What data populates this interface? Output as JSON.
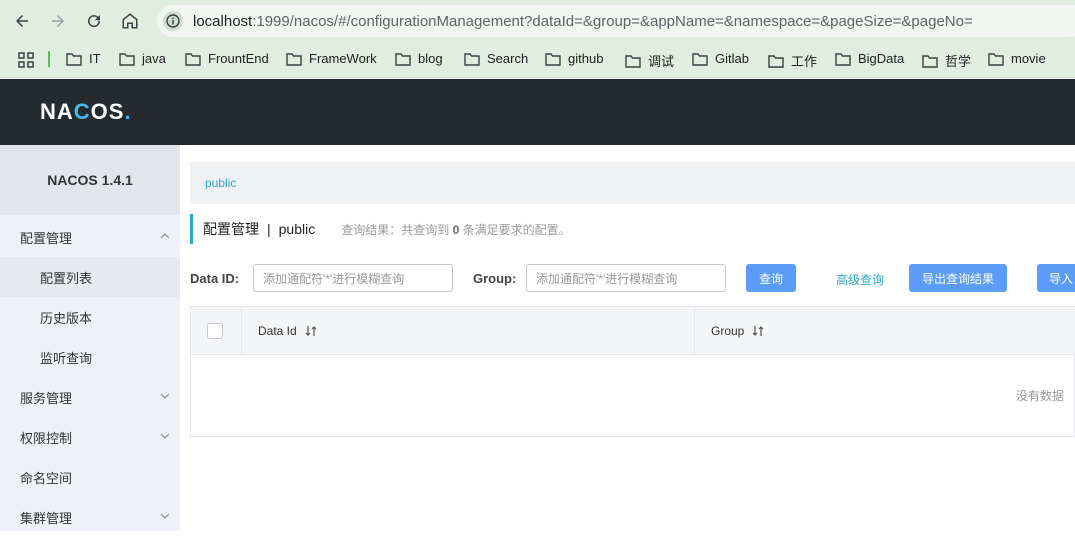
{
  "browser": {
    "url_host": "localhost",
    "url_rest": ":1999/nacos/#/configurationManagement?dataId=&group=&appName=&namespace=&pageSize=&pageNo=",
    "bookmarks": [
      "IT",
      "java",
      "FrountEnd",
      "FrameWork",
      "blog",
      "Search",
      "github",
      "调试",
      "Gitlab",
      "工作",
      "BigData",
      "哲学",
      "movie"
    ]
  },
  "app": {
    "logo": {
      "a": "NA",
      "b": "C",
      "c": "OS",
      "dot": "."
    },
    "version_title": "NACOS 1.4.1"
  },
  "sidebar": {
    "items": [
      {
        "label": "配置管理",
        "type": "group",
        "chevron": "up"
      },
      {
        "label": "配置列表",
        "type": "sub",
        "active": true
      },
      {
        "label": "历史版本",
        "type": "sub"
      },
      {
        "label": "监听查询",
        "type": "sub"
      },
      {
        "label": "服务管理",
        "type": "group",
        "chevron": "down"
      },
      {
        "label": "权限控制",
        "type": "group",
        "chevron": "down"
      },
      {
        "label": "命名空间",
        "type": "group"
      },
      {
        "label": "集群管理",
        "type": "group",
        "chevron": "down"
      }
    ]
  },
  "main": {
    "namespace_link": "public",
    "title": "配置管理",
    "title_sep": "|",
    "title_ns": "public",
    "result_prefix": "查询结果：共查询到",
    "result_count": "0",
    "result_suffix": "条满足要求的配置。",
    "search": {
      "dataid_label": "Data ID:",
      "dataid_placeholder": "添加通配符'*'进行模糊查询",
      "group_label": "Group:",
      "group_placeholder": "添加通配符'*'进行模糊查询",
      "query_button": "查询",
      "advanced_link": "高级查询",
      "export_button": "导出查询结果",
      "import_button": "导入"
    },
    "table": {
      "columns": [
        "Data Id",
        "Group"
      ],
      "empty_text": "没有数据"
    }
  },
  "colors": {
    "header_bg": "#252a2f",
    "accent": "#2da7c8",
    "primary_button": "#5a9cf8",
    "sidebar_bg": "#eef2f6"
  }
}
